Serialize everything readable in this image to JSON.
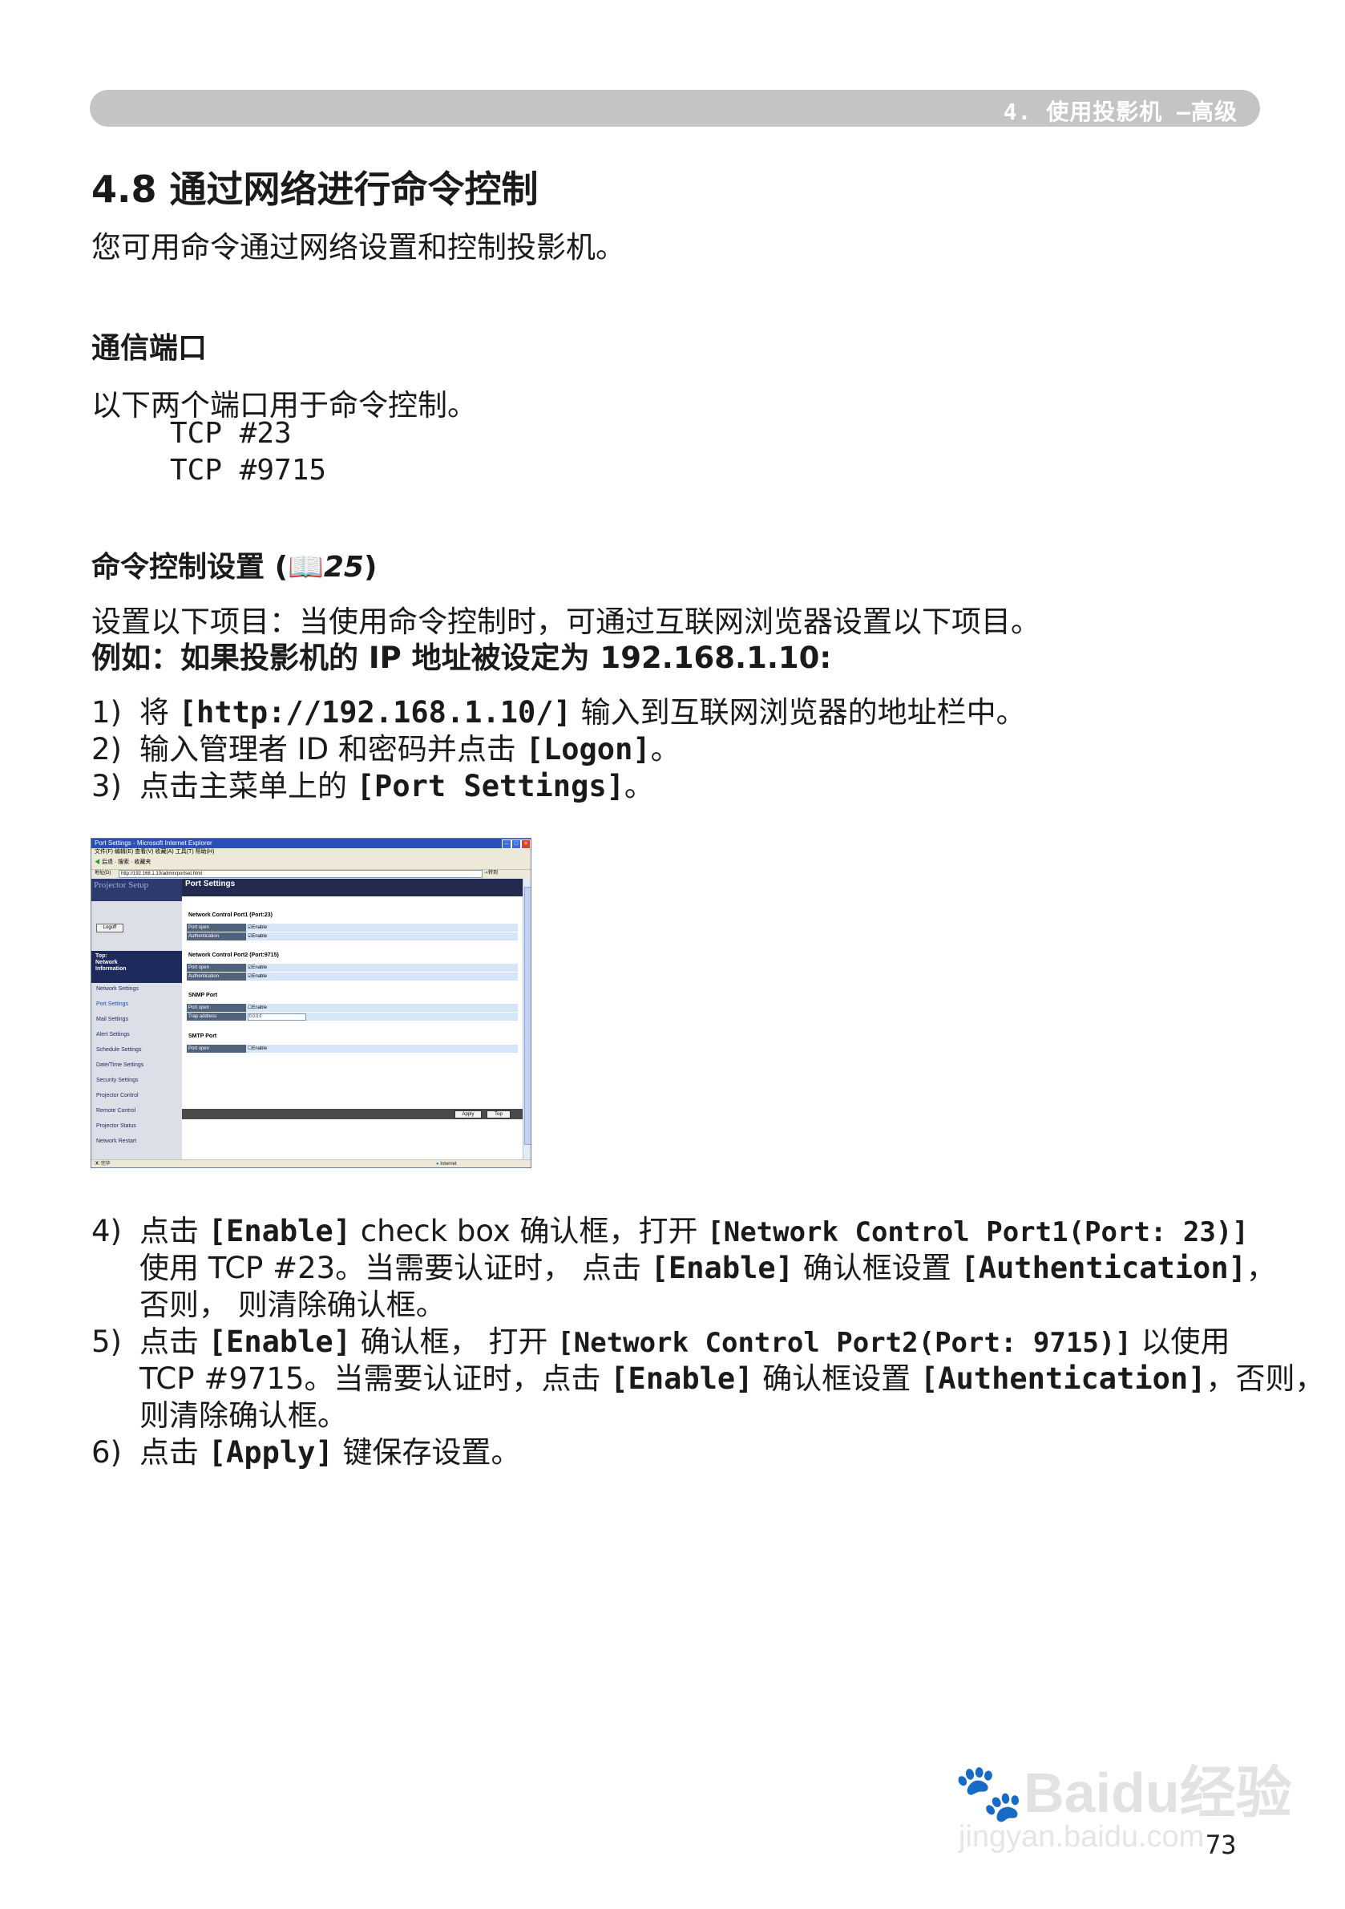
{
  "header": {
    "chapter": "4. 使用投影机 —高级"
  },
  "title": "4.8 通过网络进行命令控制",
  "intro": "您可用命令通过网络设置和控制投影机。",
  "ports": {
    "heading": "通信端口",
    "text": "以下两个端口用于命令控制。",
    "port1": "TCP #23",
    "port2": "TCP #9715"
  },
  "settings": {
    "heading": "命令控制设置",
    "ref_open": "(",
    "ref_icon": "📖",
    "ref_page": "25",
    "ref_close": ")",
    "line1": "设置以下项目：当使用命令控制时，可通过互联网浏览器设置以下项目。",
    "example": "例如：如果投影机的 IP 地址被设定为 192.168.1.10:"
  },
  "steps_top": [
    {
      "num": "1)",
      "pre": "将 ",
      "bold": "[http://192.168.1.10/]",
      "post": " 输入到互联网浏览器的地址栏中。"
    },
    {
      "num": "2)",
      "pre": "输入管理者 ID 和密码并点击 ",
      "bold": "[Logon]",
      "post": "。"
    },
    {
      "num": "3)",
      "pre": "点击主菜单上的 ",
      "bold": "[Port Settings]",
      "post": "。"
    }
  ],
  "browser": {
    "title": "Port Settings - Microsoft Internet Explorer",
    "menu": "文件(F)  编辑(E)  查看(V)  收藏(A)  工具(T)  帮助(H)",
    "tools": "后退  ·  搜索  ·  收藏夹",
    "addr_label": "地址(D)",
    "url": "http://192.168.1.10/admin/portset.html",
    "go": "转到",
    "logo": "Projector Setup",
    "logoff": "Logoff",
    "top_menu": [
      "Top:",
      "Network",
      "Information"
    ],
    "menu_items": [
      "Network Settings",
      "Port Settings",
      "Mail Settings",
      "Alert Settings",
      "Schedule Settings",
      "Date/Time Settings",
      "Security Settings",
      "Projector Control",
      "Remote Control",
      "Projector Status",
      "Network Restart"
    ],
    "page_title": "Port Settings",
    "sections": [
      {
        "title": "Network Control Port1 (Port:23)",
        "rows": [
          {
            "label": "Port open",
            "value": "☑Enable"
          },
          {
            "label": "Authentication",
            "value": "☑Enable"
          }
        ]
      },
      {
        "title": "Network Control Port2 (Port:9715)",
        "rows": [
          {
            "label": "Port open",
            "value": "☑Enable"
          },
          {
            "label": "Authentication",
            "value": "☑Enable"
          }
        ]
      },
      {
        "title": "SNMP Port",
        "rows": [
          {
            "label": "Port open",
            "value": "☐Enable"
          },
          {
            "label": "Trap address",
            "value": "0.0.0.0"
          }
        ]
      },
      {
        "title": "SMTP Port",
        "rows": [
          {
            "label": "Port open",
            "value": "☐Enable"
          }
        ]
      }
    ],
    "apply": "Apply",
    "top": "Top",
    "status_left": "完毕",
    "status_right": "Internet"
  },
  "steps_bottom": [
    {
      "num": "4)",
      "lines": [
        [
          {
            "t": "点击 "
          },
          {
            "t": "[Enable]",
            "b": true
          },
          {
            "t": " check box 确认框，打开 "
          },
          {
            "t": "[Network Control Port1(Port: 23)]",
            "b": true
          }
        ],
        [
          {
            "t": "使用 TCP #23。当需要认证时， 点击 "
          },
          {
            "t": "[Enable]",
            "b": true
          },
          {
            "t": " 确认框设置 "
          },
          {
            "t": "[Authentication]",
            "b": true
          },
          {
            "t": "，"
          }
        ],
        [
          {
            "t": "否则， 则清除确认框。"
          }
        ]
      ]
    },
    {
      "num": "5)",
      "lines": [
        [
          {
            "t": "点击 "
          },
          {
            "t": "[Enable]",
            "b": true
          },
          {
            "t": " 确认框， 打开 "
          },
          {
            "t": "[Network Control Port2(Port: 9715)]",
            "b": true
          },
          {
            "t": " 以使用"
          }
        ],
        [
          {
            "t": "TCP #9715。当需要认证时，点击 "
          },
          {
            "t": "[Enable]",
            "b": true
          },
          {
            "t": " 确认框设置 "
          },
          {
            "t": "[Authentication]",
            "b": true
          },
          {
            "t": "，否则，"
          }
        ],
        [
          {
            "t": "则清除确认框。"
          }
        ]
      ]
    },
    {
      "num": "6)",
      "lines": [
        [
          {
            "t": "点击 "
          },
          {
            "t": "[Apply]",
            "b": true
          },
          {
            "t": " 键保存设置。"
          }
        ]
      ]
    }
  ],
  "watermark": {
    "brand": "Baidu经验",
    "site": "jingyan.baidu.com"
  },
  "page_number": "73"
}
